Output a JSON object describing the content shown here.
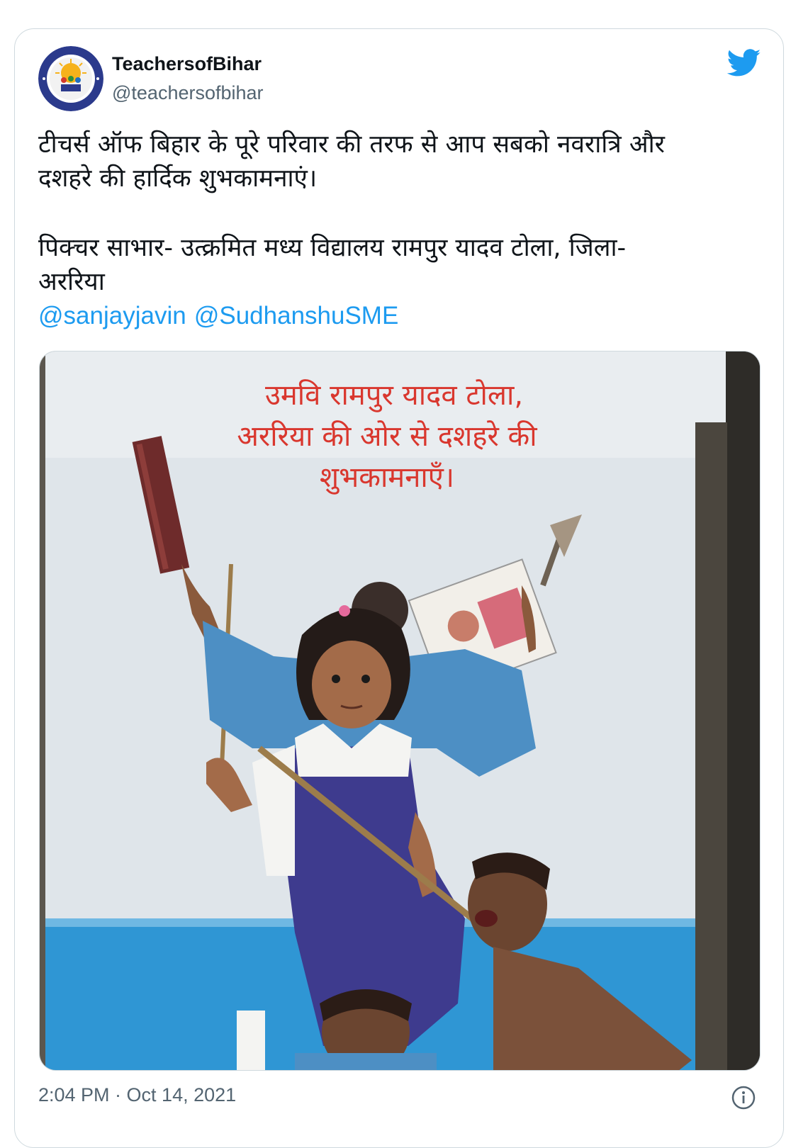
{
  "tweet": {
    "display_name": "TeachersofBihar",
    "handle": "@teachersofbihar",
    "text_line1": "टीचर्स ऑफ बिहार के पूरे परिवार की तरफ से आप सबको नवरात्रि और",
    "text_line2": "दशहरे की हार्दिक शुभकामनाएं।",
    "credit_line1": "पिक्चर साभार- उत्क्रमित मध्य विद्यालय रामपुर यादव टोला, जिला-",
    "credit_line2": "अररिया",
    "mentions": [
      "@sanjayjavin",
      "@SudhanshuSME"
    ],
    "timestamp": "2:04 PM · Oct 14, 2021"
  },
  "photo": {
    "wall_text_line1": "उमवि रामपुर यादव टोला,",
    "wall_text_line2": "अररिया की ओर से दशहरे की",
    "wall_text_line3": "शुभकामनाएँ।"
  },
  "icons": {
    "brand": "twitter-bird-icon",
    "info": "info-icon"
  },
  "colors": {
    "link": "#1d9bf0",
    "primary_text": "#0f1419",
    "secondary_text": "#536471",
    "border": "#cfd9de",
    "wall_text": "#d9372e"
  }
}
